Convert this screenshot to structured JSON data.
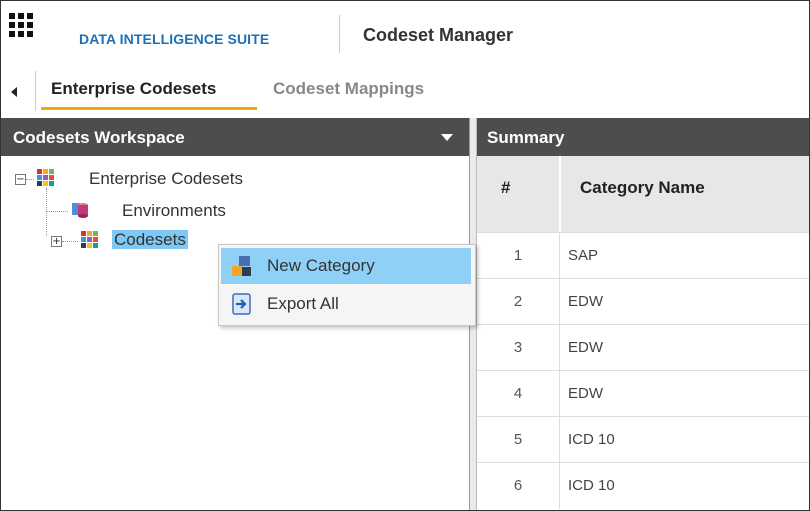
{
  "header": {
    "suite_name": "DATA INTELLIGENCE SUITE",
    "app_name": "Codeset Manager"
  },
  "tabs": [
    {
      "label": "Enterprise Codesets",
      "active": true
    },
    {
      "label": "Codeset Mappings",
      "active": false
    }
  ],
  "workspace": {
    "title": "Codesets Workspace",
    "tree": {
      "root": "Enterprise Codesets",
      "environments": "Environments",
      "codesets": "Codesets"
    }
  },
  "context_menu": {
    "items": [
      {
        "label": "New Category",
        "icon": "new-category-icon",
        "highlighted": true
      },
      {
        "label": "Export All",
        "icon": "export-icon",
        "highlighted": false
      }
    ]
  },
  "summary": {
    "title": "Summary",
    "columns": [
      "#",
      "Category Name"
    ],
    "rows": [
      {
        "num": "1",
        "name": "SAP"
      },
      {
        "num": "2",
        "name": "EDW"
      },
      {
        "num": "3",
        "name": "EDW"
      },
      {
        "num": "4",
        "name": "EDW"
      },
      {
        "num": "5",
        "name": "ICD 10"
      },
      {
        "num": "6",
        "name": "ICD 10"
      }
    ]
  },
  "colors": {
    "accent": "#f2a900",
    "brand": "#1d6fb8",
    "panel_header": "#4d4d4d",
    "selection": "#7dc8f4"
  }
}
